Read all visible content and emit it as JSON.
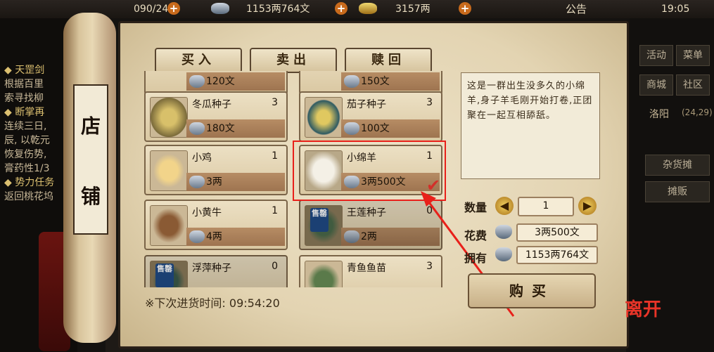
{
  "hud": {
    "bag": "090/240",
    "silver": "1153两764文",
    "gold": "3157两",
    "notice": "公告",
    "clock": "19:05"
  },
  "quests": {
    "lines": [
      "◆ 天罡剑",
      "根据百里",
      "索寻找柳",
      "◆ 断掌再",
      "连续三日,",
      "辰, 以乾元",
      "恢复伤势,",
      "膏药性1/3",
      "◆ 势力任务",
      "返回桃花坞"
    ]
  },
  "right_panel": {
    "btn1": "活动",
    "btn2": "菜单",
    "btn3": "商城",
    "btn4": "社区",
    "location": "洛阳",
    "coords": "(24,29)",
    "stall": "杂货摊",
    "vend": "摊贩"
  },
  "scroll": {
    "char1": "店",
    "char2": "铺"
  },
  "tabs": {
    "buy": "买入",
    "sell": "卖出",
    "redeem": "赎回"
  },
  "items": [
    {
      "name": "",
      "qty": "",
      "price": "120文"
    },
    {
      "name": "",
      "qty": "",
      "price": "150文"
    },
    {
      "name": "冬瓜种子",
      "qty": "3",
      "price": "180文"
    },
    {
      "name": "茄子种子",
      "qty": "3",
      "price": "100文"
    },
    {
      "name": "小鸡",
      "qty": "1",
      "price": "3两"
    },
    {
      "name": "小绵羊",
      "qty": "1",
      "price": "3两500文"
    },
    {
      "name": "小黄牛",
      "qty": "1",
      "price": "4两"
    },
    {
      "name": "王莲种子",
      "qty": "0",
      "price": "2两"
    },
    {
      "name": "浮萍种子",
      "qty": "0",
      "price": ""
    },
    {
      "name": "青鱼鱼苗",
      "qty": "3",
      "price": ""
    }
  ],
  "seal_text": "售罄",
  "description": "这是一群出生没多久的小绵羊,身子羊毛刚开始打卷,正团聚在一起互相舔舐。",
  "purchase": {
    "qty_label": "数量",
    "qty_value": "1",
    "cost_label": "花费",
    "cost_value": "3两500文",
    "have_label": "拥有",
    "have_value": "1153两764文",
    "buy_button": "购买"
  },
  "restock": {
    "label": "※下次进货时间:",
    "time": "09:54:20"
  },
  "leave": "离开",
  "colors": {
    "highlight": "#e8201a",
    "paper": "#e3d4b2",
    "sold_out_seal": "#1f4a86"
  }
}
